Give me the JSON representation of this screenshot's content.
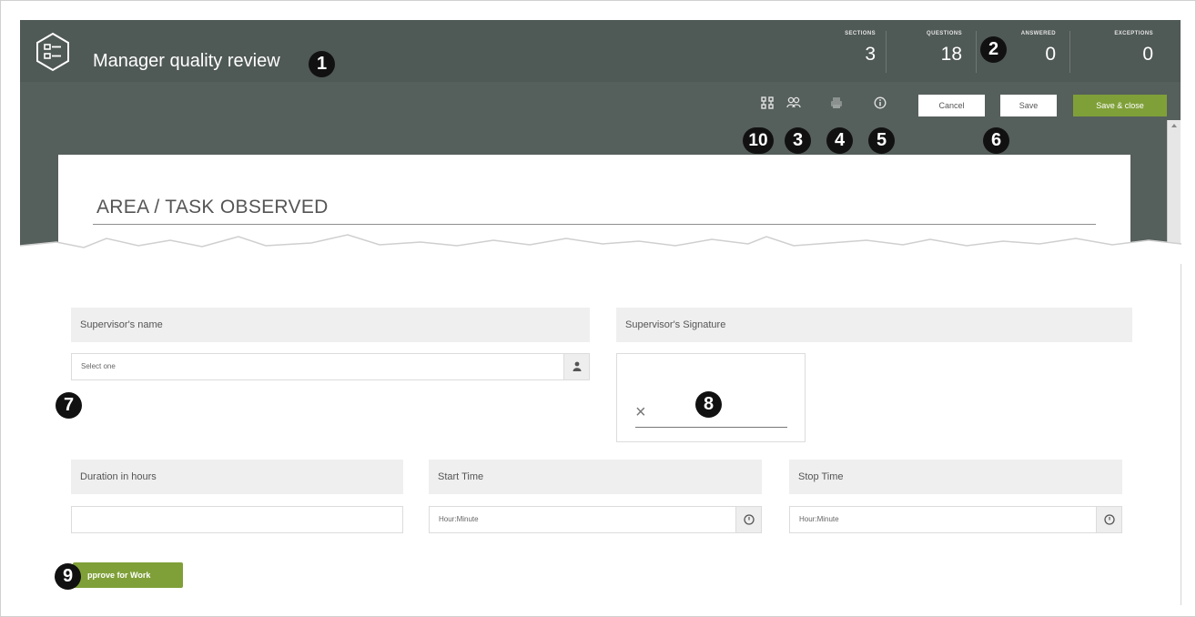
{
  "header": {
    "title": "Manager quality review",
    "logo_icon": "checklist-hexagon-icon"
  },
  "stats": [
    {
      "label": "SECTIONS",
      "value": "3"
    },
    {
      "label": "QUESTIONS",
      "value": "18"
    },
    {
      "label": "ANSWERED",
      "value": "0"
    },
    {
      "label": "EXCEPTIONS",
      "value": "0"
    }
  ],
  "toolbar": {
    "icons": [
      "workflow-icon",
      "users-icon",
      "print-icon",
      "info-icon"
    ],
    "cancel_label": "Cancel",
    "save_label": "Save",
    "save_close_label": "Save & close"
  },
  "section": {
    "title": "AREA / TASK OBSERVED"
  },
  "form": {
    "supervisor_name_label": "Supervisor's name",
    "supervisor_name_placeholder": "Select one",
    "supervisor_signature_label": "Supervisor's Signature",
    "signature_mark": "×",
    "duration_label": "Duration in hours",
    "duration_value": "",
    "start_time_label": "Start Time",
    "start_time_placeholder": "Hour:Minute",
    "stop_time_label": "Stop Time",
    "stop_time_placeholder": "Hour:Minute",
    "approve_label": "pprove for Work"
  },
  "callouts": [
    "1",
    "2",
    "3",
    "4",
    "5",
    "6",
    "7",
    "8",
    "9",
    "10"
  ],
  "colors": {
    "header_bg": "#4f5955",
    "body_bg": "#555f5b",
    "accent_green": "#7fa038",
    "callout_bg": "#111111"
  }
}
